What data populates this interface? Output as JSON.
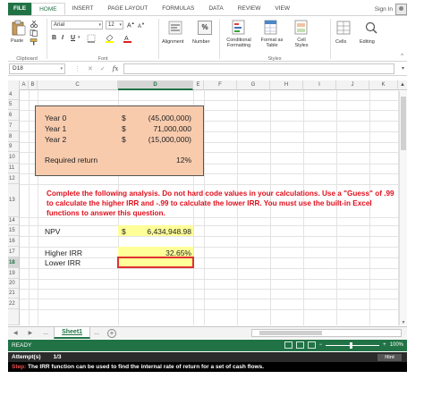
{
  "ribbon": {
    "tabs": [
      "FILE",
      "HOME",
      "INSERT",
      "PAGE LAYOUT",
      "FORMULAS",
      "DATA",
      "REVIEW",
      "VIEW"
    ],
    "sign_in": "Sign In",
    "paste": "Paste",
    "font_name": "Arial",
    "font_size": "12",
    "bold": "B",
    "italic": "I",
    "underline": "U",
    "alignment": "Alignment",
    "number": "Number",
    "conditional_formatting": "Conditional\nFormatting",
    "format_as_table": "Format as\nTable",
    "cell_styles": "Cell\nStyles",
    "cells": "Cells",
    "editing": "Editing",
    "group_clipboard": "Clipboard",
    "group_font": "Font",
    "group_styles": "Styles",
    "percent_symbol": "%"
  },
  "formula_bar": {
    "name_box": "D18",
    "cancel": "✕",
    "enter": "✓",
    "fx": "fx"
  },
  "columns": [
    "A",
    "B",
    "C",
    "D",
    "E",
    "F",
    "G",
    "H",
    "I",
    "J",
    "K"
  ],
  "rows": [
    "4",
    "5",
    "6",
    "7",
    "8",
    "9",
    "10",
    "11",
    "12",
    "13",
    "14",
    "15",
    "16",
    "17",
    "18",
    "19",
    "20",
    "21",
    "22"
  ],
  "selected_cell": {
    "column": "D",
    "row": "18"
  },
  "cells": {
    "year0_label": "Year 0",
    "year1_label": "Year 1",
    "year2_label": "Year 2",
    "year0_currency": "$",
    "year1_currency": "$",
    "year2_currency": "$",
    "year0_value": "(45,000,000)",
    "year1_value": "71,000,000",
    "year2_value": "(15,000,000)",
    "required_return_label": "Required return",
    "required_return_value": "12%",
    "instructions": "Complete the following analysis. Do not hard code values in your calculations. Use a \"Guess\" of .99 to calculate the higher IRR and -.99 to calculate the lower IRR. You must use the built-in Excel functions to answer this question.",
    "npv_label": "NPV",
    "npv_currency": "$",
    "npv_value": "6,434,948.98",
    "higher_irr_label": "Higher IRR",
    "higher_irr_value": "32.65%",
    "lower_irr_label": "Lower IRR",
    "lower_irr_value": ""
  },
  "sheet_tabs": {
    "prev_dots": "...",
    "active": "Sheet1",
    "next_dots": "...",
    "add": "+"
  },
  "status": {
    "ready": "READY",
    "zoom": "100%",
    "zoom_minus": "−",
    "zoom_plus": "+"
  },
  "attempts": {
    "label": "Attempt(s)",
    "value": "1/3",
    "hint": "Hint"
  },
  "step": {
    "prefix": "Step:",
    "text": " The IRR function can be used to find the internal rate of return for a set of cash flows."
  },
  "colors": {
    "excel_green": "#217346",
    "orange_fill": "#f8cbad",
    "yellow_fill": "#ffff99",
    "instruction_red": "#e0101d"
  }
}
